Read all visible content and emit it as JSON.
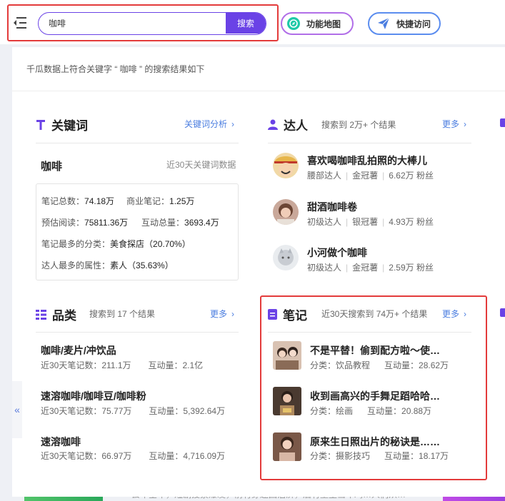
{
  "header": {
    "search_value": "咖啡",
    "search_button": "搜索",
    "function_map": "功能地图",
    "quick_access": "快捷访问"
  },
  "summary": "千瓜数据上符合关键字 “ 咖啡 ” 的搜索结果如下",
  "keywords": {
    "title": "关键词",
    "more": "关键词分析",
    "word": "咖啡",
    "note": "近30天关键词数据",
    "stats": {
      "notes_total_label": "笔记总数：",
      "notes_total": "74.18万",
      "commercial_label": "商业笔记：",
      "commercial": "1.25万",
      "est_reads_label": "预估阅读：",
      "est_reads": "75811.36万",
      "interactions_label": "互动总量：",
      "interactions": "3693.4万",
      "top_category_label": "笔记最多的分类：",
      "top_category": "美食探店（20.70%）",
      "top_attribute_label": "达人最多的属性：",
      "top_attribute": "素人（35.63%）"
    }
  },
  "talents": {
    "title": "达人",
    "count": "搜索到 2万+ 个结果",
    "more": "更多",
    "items": [
      {
        "name": "喜欢喝咖啡乱拍照的大棒儿",
        "level": "腰部达人",
        "rank": "金冠薯",
        "fans": "6.62万 粉丝"
      },
      {
        "name": "甜酒咖啡卷",
        "level": "初级达人",
        "rank": "银冠薯",
        "fans": "4.93万 粉丝"
      },
      {
        "name": "小河做个咖啡",
        "level": "初级达人",
        "rank": "金冠薯",
        "fans": "2.59万 粉丝"
      }
    ]
  },
  "categories": {
    "title": "品类",
    "count": "搜索到 17 个结果",
    "more": "更多",
    "items": [
      {
        "name": "咖啡/麦片/冲饮品",
        "notes": "近30天笔记数：211.1万",
        "interactions": "互动量：2.1亿"
      },
      {
        "name": "速溶咖啡/咖啡豆/咖啡粉",
        "notes": "近30天笔记数：75.77万",
        "interactions": "互动量：5,392.64万"
      },
      {
        "name": "速溶咖啡",
        "notes": "近30天笔记数：66.97万",
        "interactions": "互动量：4,716.09万"
      }
    ]
  },
  "notes": {
    "title": "笔记",
    "count": "近30天搜索到 74万+ 个结果",
    "more": "更多",
    "items": [
      {
        "title": "不是平替！偷到配方啦～使…",
        "category": "分类：饮品教程",
        "interactions": "互动量：28.62万"
      },
      {
        "title": "收到画高兴的手舞足蹈哈哈…",
        "category": "分类：绘画",
        "interactions": "互动量：20.88万"
      },
      {
        "title": "原来生日照出片的秘诀是……",
        "category": "分类：摄影技巧",
        "interactions": "互动量：18.17万"
      }
    ]
  },
  "bottom_text": "去年全年，短剧搜索爆发，前有穿越回沾济，后有重生当年鸡…人们从…",
  "colors": {
    "accent": "#6a42e6",
    "link": "#4a7de0",
    "highlight_box": "#e33b3b"
  }
}
